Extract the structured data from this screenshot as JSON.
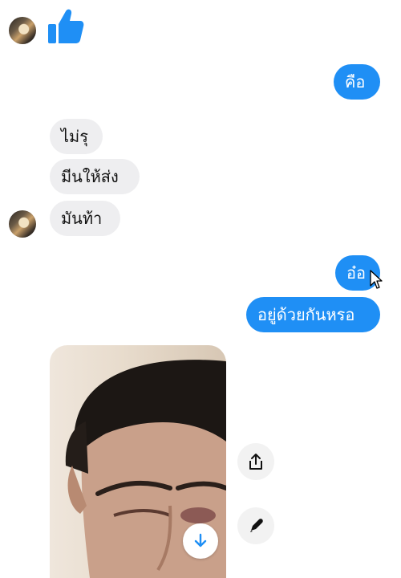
{
  "messages": {
    "out_1": "คือ",
    "in_1": "ไม่รุ",
    "in_2": "มีนให้ส่ง",
    "in_3": "มันท้า",
    "out_2": "อ๋อ",
    "out_3": "อยู่ด้วยกันหรอ"
  },
  "icons": {
    "like": "thumbs-up-icon",
    "share": "share-icon",
    "edit": "pencil-icon",
    "download": "download-icon"
  },
  "colors": {
    "outgoing_bubble": "#1f8ff5",
    "incoming_bubble": "#eeeef0",
    "like": "#1f8ff5"
  }
}
